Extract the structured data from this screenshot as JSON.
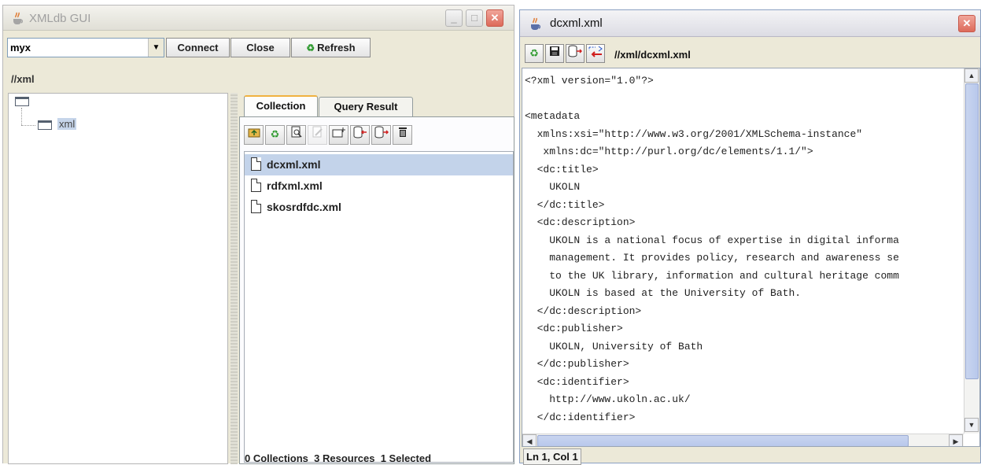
{
  "left_window": {
    "title": "XMLdb GUI",
    "connection": {
      "selected": "myx",
      "connect_label": "Connect",
      "close_label": "Close",
      "refresh_label": "Refresh"
    },
    "path": "//xml",
    "tree": {
      "child_label": "xml"
    },
    "tabs": [
      {
        "label": "Collection",
        "active": true
      },
      {
        "label": "Query Result",
        "active": false
      }
    ],
    "files": [
      {
        "name": "dcxml.xml",
        "selected": true
      },
      {
        "name": "rdfxml.xml",
        "selected": false
      },
      {
        "name": "skosrdfdc.xml",
        "selected": false
      }
    ],
    "status": {
      "collections": "0 Collections",
      "resources": "3 Resources",
      "selected": "1 Selected"
    }
  },
  "right_window": {
    "title": "dcxml.xml",
    "doc_path": "//xml/dcxml.xml",
    "code_lines": [
      "<?xml version=\"1.0\"?>",
      "",
      "<metadata",
      "  xmlns:xsi=\"http://www.w3.org/2001/XMLSchema-instance\"",
      "   xmlns:dc=\"http://purl.org/dc/elements/1.1/\">",
      "  <dc:title>",
      "    UKOLN",
      "  </dc:title>",
      "  <dc:description>",
      "    UKOLN is a national focus of expertise in digital informa",
      "    management. It provides policy, research and awareness se",
      "    to the UK library, information and cultural heritage comm",
      "    UKOLN is based at the University of Bath.",
      "  </dc:description>",
      "  <dc:publisher>",
      "    UKOLN, University of Bath",
      "  </dc:publisher>",
      "  <dc:identifier>",
      "    http://www.ukoln.ac.uk/",
      "  </dc:identifier>"
    ],
    "caret_status": "Ln 1, Col 1"
  },
  "icons": {
    "app": "java-cup-icon",
    "tree_root": "folder-icon",
    "tree_child": "folder-icon",
    "collection_toolbar": [
      "up-folder-icon",
      "refresh-icon",
      "view-icon",
      "edit-icon",
      "new-collection-icon",
      "import-icon",
      "export-icon",
      "delete-icon"
    ],
    "editor_toolbar": [
      "refresh-icon",
      "save-icon",
      "export-icon",
      "import-icon"
    ]
  },
  "colors": {
    "selection": "#c3d3ea",
    "active_tab_accent": "#f0b240",
    "refresh_green": "#2e9a2e",
    "close_red": "#dd6a5a"
  }
}
